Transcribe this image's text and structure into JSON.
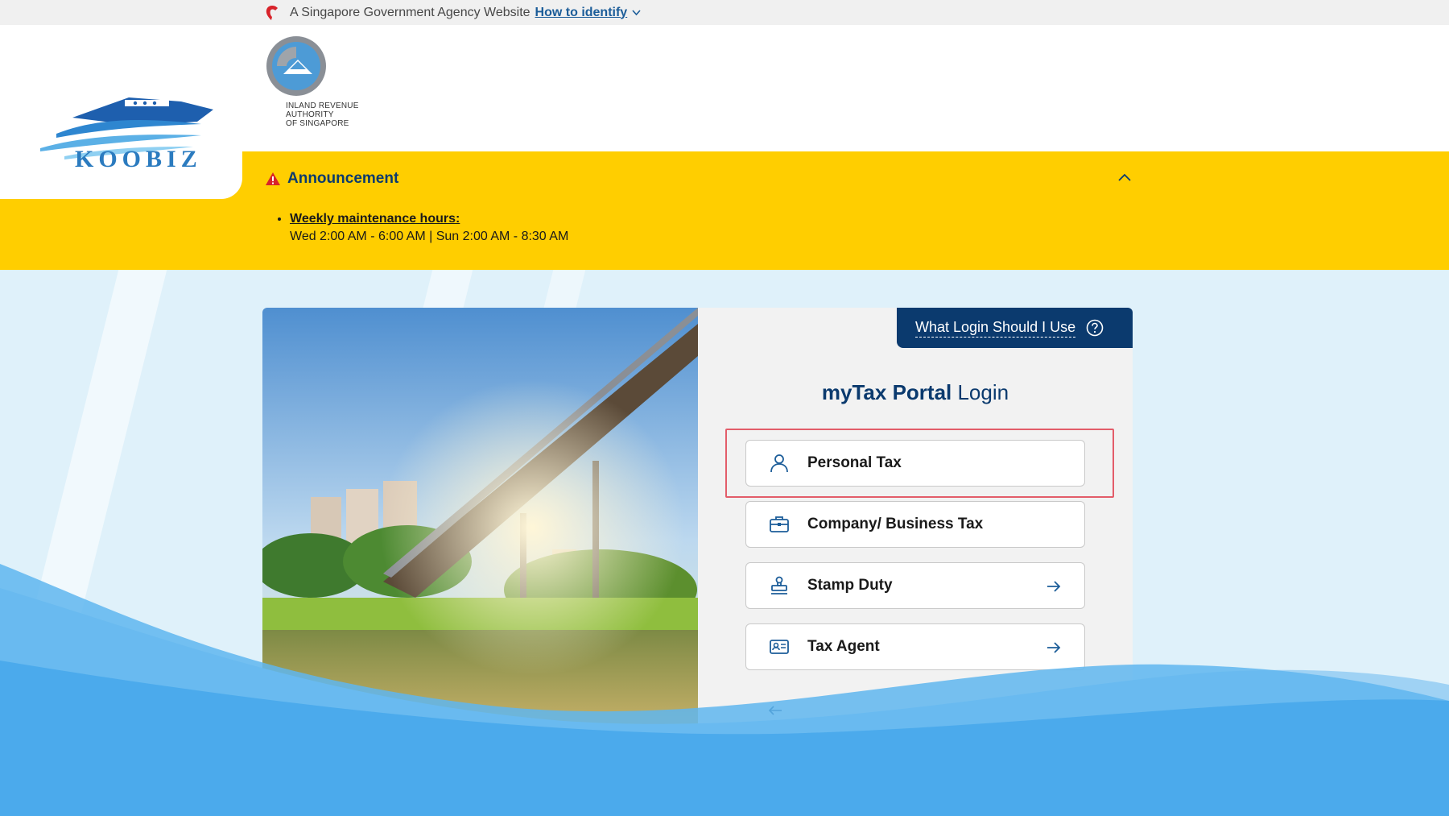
{
  "masthead": {
    "text": "A Singapore Government Agency Website",
    "link": "How to identify"
  },
  "brand": {
    "overlay_logo": "KOOBIZ",
    "agency_lines": [
      "INLAND REVENUE",
      "AUTHORITY",
      "OF SINGAPORE"
    ]
  },
  "announcement": {
    "title": "Announcement",
    "item_heading": "Weekly maintenance hours:",
    "item_body": "Wed 2:00 AM - 6:00 AM | Sun 2:00 AM - 8:30 AM"
  },
  "login": {
    "help_button": "What Login Should I Use",
    "title_bold": "myTax Portal",
    "title_rest": " Login",
    "options": [
      {
        "label": "Personal Tax",
        "icon": "person-icon",
        "arrow": false
      },
      {
        "label": "Company/ Business Tax",
        "icon": "briefcase-icon",
        "arrow": false
      },
      {
        "label": "Stamp Duty",
        "icon": "stamp-icon",
        "arrow": true
      },
      {
        "label": "Tax Agent",
        "icon": "id-card-icon",
        "arrow": true
      }
    ]
  },
  "colors": {
    "navy": "#0b3a6e",
    "announcement_bg": "#ffce00",
    "highlight": "#e35d6a",
    "link": "#1c5d99"
  }
}
